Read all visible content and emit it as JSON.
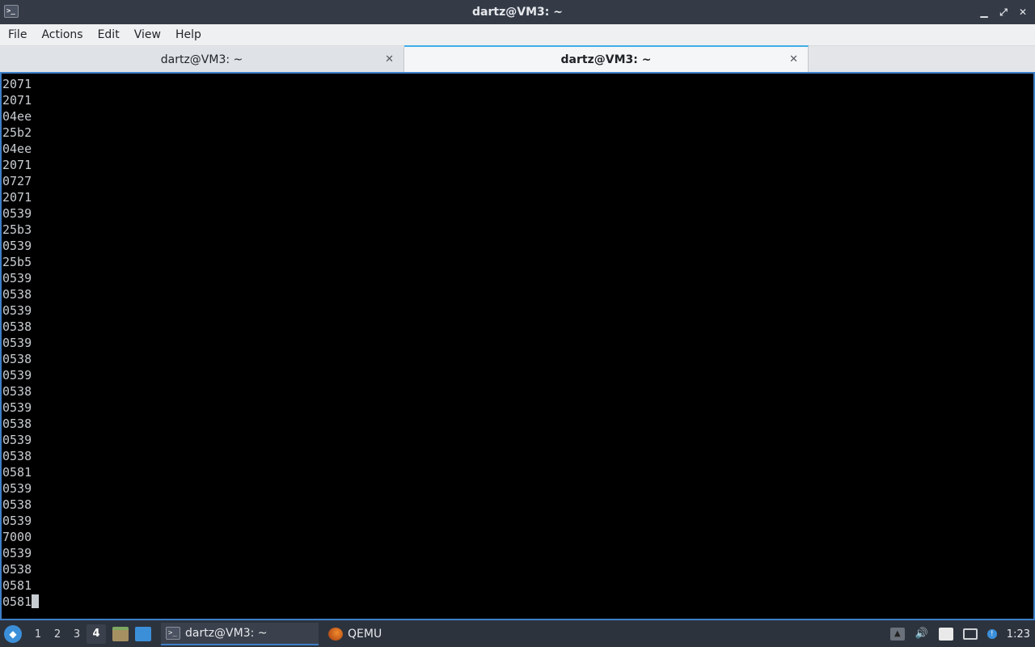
{
  "window": {
    "title": "dartz@VM3: ~",
    "app_icon": "terminal-icon",
    "buttons": {
      "minimize": "▁",
      "maximize": "⤢",
      "close": "✕"
    }
  },
  "menubar": {
    "items": [
      "File",
      "Actions",
      "Edit",
      "View",
      "Help"
    ]
  },
  "tabs": [
    {
      "label": "dartz@VM3: ~",
      "active": false,
      "close": "✕"
    },
    {
      "label": "dartz@VM3: ~",
      "active": true,
      "close": "✕"
    }
  ],
  "terminal": {
    "lines": [
      "2071",
      "2071",
      "04ee",
      "25b2",
      "04ee",
      "2071",
      "0727",
      "2071",
      "0539",
      "25b3",
      "0539",
      "25b5",
      "0539",
      "0538",
      "0539",
      "0538",
      "0539",
      "0538",
      "0539",
      "0538",
      "0539",
      "0538",
      "0539",
      "0538",
      "0581",
      "0539",
      "0538",
      "0539",
      "7000",
      "0539",
      "0538",
      "0581",
      "0581"
    ],
    "colors": {
      "background": "#000000",
      "foreground": "#c8cdd1",
      "border": "#3d7fc7"
    }
  },
  "taskbar": {
    "desktops": [
      "1",
      "2",
      "3",
      "4"
    ],
    "active_desktop": "4",
    "tasks": [
      {
        "label": "dartz@VM3: ~",
        "icon": "terminal-icon",
        "active": true
      },
      {
        "label": "QEMU",
        "icon": "qemu-icon",
        "active": false
      }
    ],
    "clock": "1:23"
  }
}
